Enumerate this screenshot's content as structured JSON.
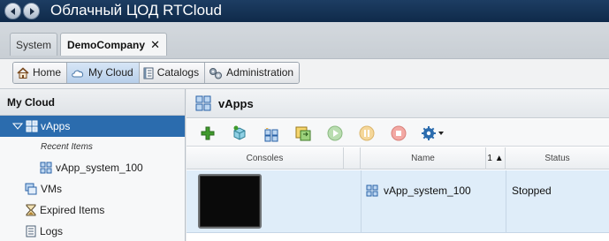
{
  "app": {
    "title": "Облачный ЦОД RTCloud"
  },
  "tabs": [
    {
      "label": "System"
    },
    {
      "label": "DemoCompany",
      "close": "✕"
    }
  ],
  "nav": {
    "home": "Home",
    "my_cloud": "My Cloud",
    "catalogs": "Catalogs",
    "administration": "Administration"
  },
  "left": {
    "header": "My Cloud",
    "vapps": "vApps",
    "recent": "Recent Items",
    "recent_item": "vApp_system_100",
    "vms": "VMs",
    "expired": "Expired Items",
    "logs": "Logs"
  },
  "main": {
    "title": "vApps",
    "columns": {
      "consoles": "Consoles",
      "name": "Name",
      "sort": "1 ▲",
      "status": "Status"
    },
    "rows": [
      {
        "name": "vApp_system_100",
        "status": "Stopped"
      }
    ]
  },
  "colors": {
    "accent": "#2b6cae",
    "titlebar": "#163457",
    "row_selected": "#dfedf9"
  }
}
